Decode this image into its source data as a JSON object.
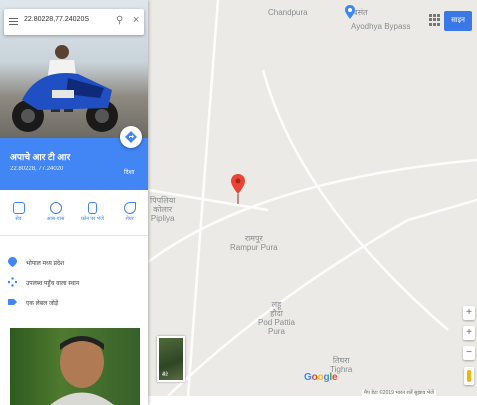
{
  "search": {
    "query": "22.80228,77.24020S"
  },
  "place": {
    "name": "अपाचे आर टी आर",
    "coordinates": "22.80228, 77.24020",
    "directions_label": "दिशा"
  },
  "actions": [
    {
      "label": "सेव",
      "icon": "bookmark-icon"
    },
    {
      "label": "आस-पास",
      "icon": "nearby-icon"
    },
    {
      "label": "फ़ोन पर भेजें",
      "icon": "phone-icon"
    },
    {
      "label": "शेयर",
      "icon": "share-icon"
    }
  ],
  "info_rows": [
    {
      "text": "भोपाल मध्य प्रदेश",
      "icon": "location-pin-icon"
    },
    {
      "text": "उपलब्ध पहुँच वाला स्थान",
      "icon": "plus-code-icon"
    },
    {
      "text": "एक लेबल जोड़ें",
      "icon": "label-icon"
    }
  ],
  "map": {
    "labels": [
      {
        "text": "Chandpura",
        "icon": "map-label"
      },
      {
        "text": "बसंत",
        "icon": "map-label"
      },
      {
        "text": "Ayodhya Bypass",
        "icon": "map-label"
      },
      {
        "text": "रामपुर\nRampur Pura",
        "icon": "map-label"
      },
      {
        "text": "पिपलिया\nकोलार\nPipliya",
        "icon": "map-label"
      },
      {
        "text": "लहू\nहौदा\nPod Pattia\nPura",
        "icon": "map-label"
      },
      {
        "text": "तिघरा\nTighra",
        "icon": "map-label"
      }
    ],
    "sign_in": "साइन",
    "satellite_label": "सैटे",
    "logo": "Google",
    "attribution": "मैप डेटा ©2019  भारत  शर्तें  सुझाव भेजें",
    "zoom_in": "+",
    "zoom_out": "−",
    "colors": {
      "brand_blue": "#4285f4",
      "pin_red": "#ea4335",
      "map_bg": "#ebeae7"
    }
  }
}
